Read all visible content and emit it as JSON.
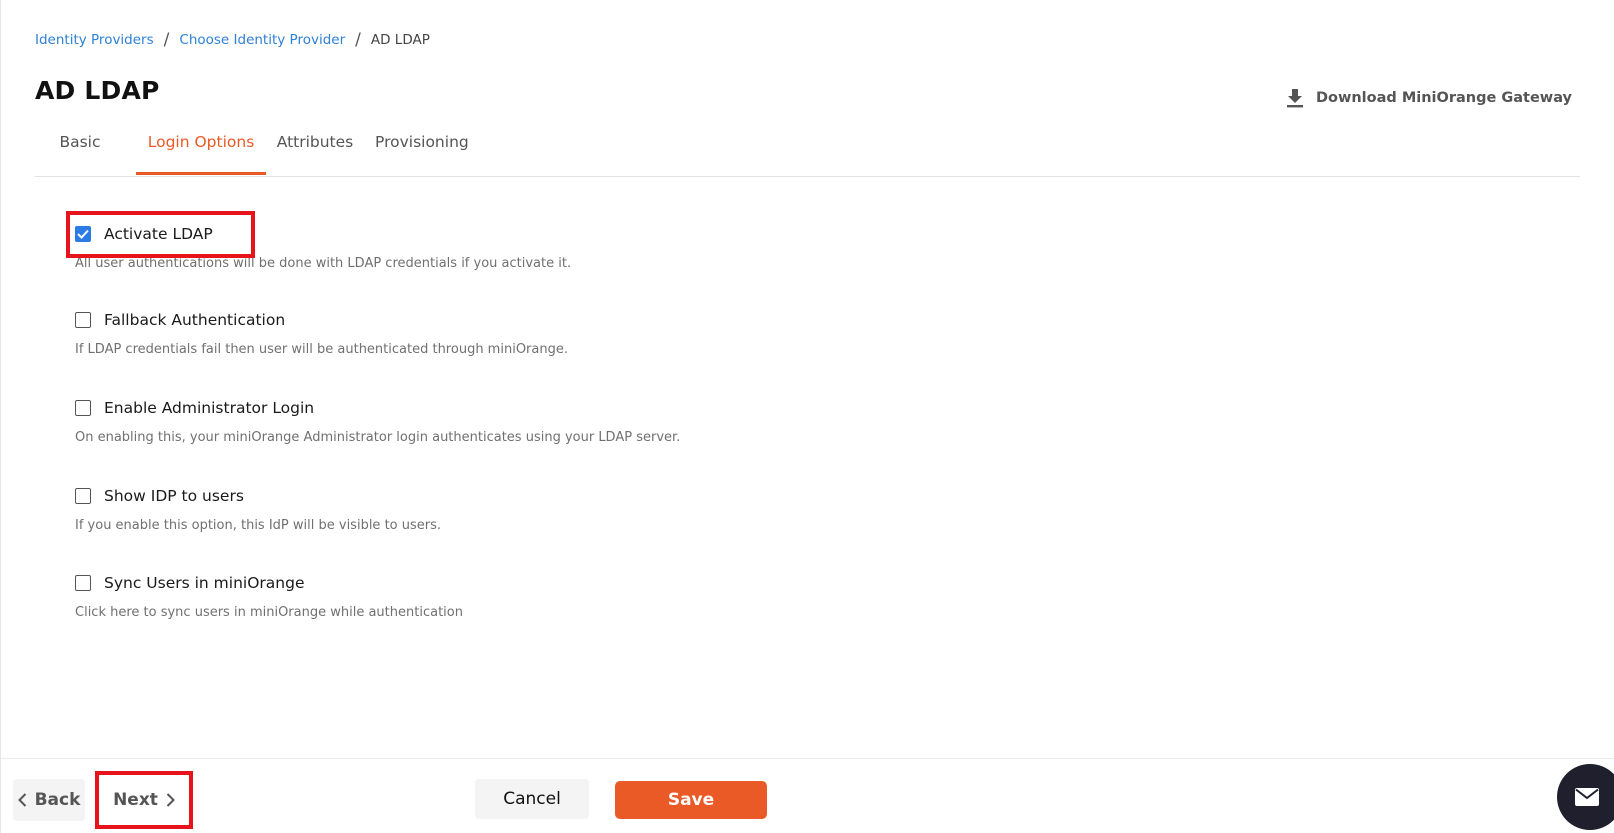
{
  "breadcrumb": {
    "items": [
      {
        "label": "Identity Providers"
      },
      {
        "label": "Choose Identity Provider"
      }
    ],
    "current": "AD LDAP",
    "separator": "/"
  },
  "page": {
    "title": "AD LDAP"
  },
  "download": {
    "label": "Download MiniOrange Gateway",
    "icon": "download-icon"
  },
  "tabs": [
    {
      "label": "Basic",
      "active": false
    },
    {
      "label": "Login Options",
      "active": true
    },
    {
      "label": "Attributes",
      "active": false
    },
    {
      "label": "Provisioning",
      "active": false
    }
  ],
  "options": [
    {
      "label": "Activate LDAP",
      "checked": true,
      "description": "All user authentications will be done with LDAP credentials if you activate it."
    },
    {
      "label": "Fallback Authentication",
      "checked": false,
      "description": "If LDAP credentials fail then user will be authenticated through miniOrange."
    },
    {
      "label": "Enable Administrator Login",
      "checked": false,
      "description": "On enabling this, your miniOrange Administrator login authenticates using your LDAP server."
    },
    {
      "label": "Show IDP to users",
      "checked": false,
      "description": "If you enable this option, this IdP will be visible to users."
    },
    {
      "label": "Sync Users in miniOrange",
      "checked": false,
      "description": "Click here to sync users in miniOrange while authentication"
    }
  ],
  "footer": {
    "back_label": "Back",
    "next_label": "Next",
    "cancel_label": "Cancel",
    "save_label": "Save"
  },
  "colors": {
    "accent": "#ea5a26",
    "link": "#2f80d6",
    "checkbox_checked": "#2a7be4",
    "highlight": "#e8141b"
  },
  "icons": {
    "back": "chevron-left-icon",
    "next": "chevron-right-icon",
    "check": "check-icon",
    "mail": "mail-icon"
  }
}
